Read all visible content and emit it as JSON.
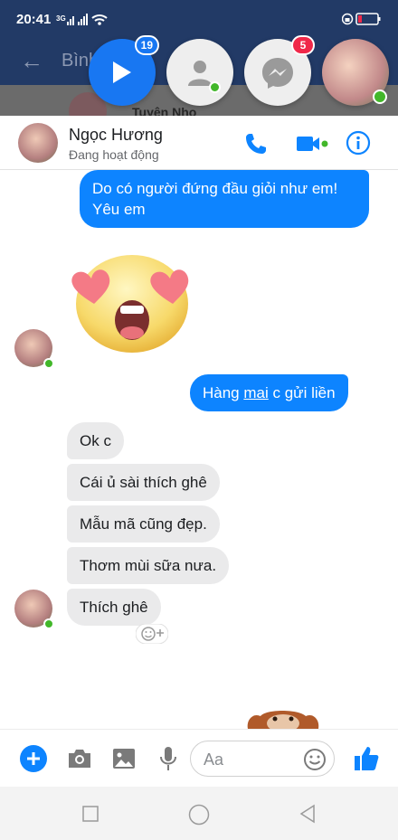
{
  "status_bar": {
    "time": "20:41",
    "network": "3G"
  },
  "background_header": {
    "title": "Bình",
    "contact_name": "Tuyên Nho"
  },
  "chat_heads": [
    {
      "name": "play",
      "badge": "19"
    },
    {
      "name": "contact",
      "badge": ""
    },
    {
      "name": "messenger",
      "badge": "5"
    },
    {
      "name": "photo",
      "badge": ""
    }
  ],
  "header": {
    "name": "Ngọc Hương",
    "status": "Đang hoạt động"
  },
  "messages": {
    "m1": "Do có người đứng đầu giỏi như em! Yêu em",
    "m2_part1": "Hàng ",
    "m2_link": "mai",
    "m2_part2": " c gửi liền",
    "m3": "Ok c",
    "m4": "Cái ủ sài thích ghê",
    "m5": "Mẫu mã cũng đẹp.",
    "m6": "Thơm mùi sữa nưa.",
    "m7": "Thích ghê"
  },
  "composer": {
    "placeholder": "Aa"
  },
  "colors": {
    "accent": "#0d84ff",
    "header_bg": "#223a66",
    "badge_red": "#f02849",
    "online": "#42b72a"
  }
}
